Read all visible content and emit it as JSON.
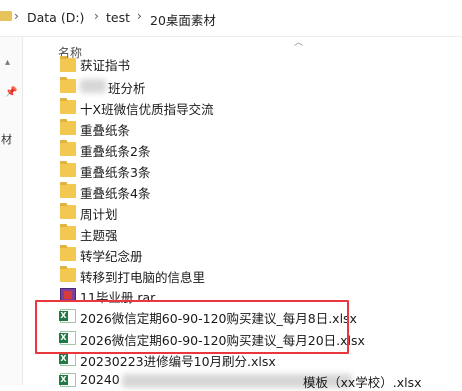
{
  "address_bar": {
    "crumbs": [
      "Data (D:)",
      "test",
      "20桌面素材"
    ],
    "separator": "›"
  },
  "nav_pane": {
    "side_text": "材"
  },
  "file_list": {
    "column_header": "名称",
    "items": [
      {
        "name": "获证指书",
        "type": "folder"
      },
      {
        "name": "班分析",
        "type": "folder"
      },
      {
        "name": "十X班微信优质指导交流",
        "type": "folder"
      },
      {
        "name": "重叠纸条",
        "type": "folder"
      },
      {
        "name": "重叠纸条2条",
        "type": "folder"
      },
      {
        "name": "重叠纸条3条",
        "type": "folder"
      },
      {
        "name": "重叠纸条4条",
        "type": "folder"
      },
      {
        "name": "周计划",
        "type": "folder"
      },
      {
        "name": "主题强",
        "type": "folder"
      },
      {
        "name": "转学纪念册",
        "type": "folder"
      },
      {
        "name": "转移到打电脑的信息里",
        "type": "folder"
      },
      {
        "name": "11毕业册.rar",
        "type": "rar"
      },
      {
        "name": "2026微信定期60-90-120购买建议_每月8日.xlsx",
        "type": "xlsx"
      },
      {
        "name": "2026微信定期60-90-120购买建议_每月20日.xlsx",
        "type": "xlsx"
      },
      {
        "name": "20230223进修编号10月刷分.xlsx",
        "type": "xlsx"
      },
      {
        "name": "20240",
        "type": "xlsx"
      }
    ],
    "last_row_tail": "模板（xx学校）.xlsx"
  },
  "icons": {
    "folder": "folder-icon",
    "xlsx": "excel-file-icon",
    "rar": "winrar-archive-icon",
    "pin": "pin-icon",
    "collapse": "chevron-up-icon"
  },
  "colors": {
    "highlight_box": "#e8383d",
    "folder": "#f3c850",
    "excel": "#1f7a44"
  }
}
